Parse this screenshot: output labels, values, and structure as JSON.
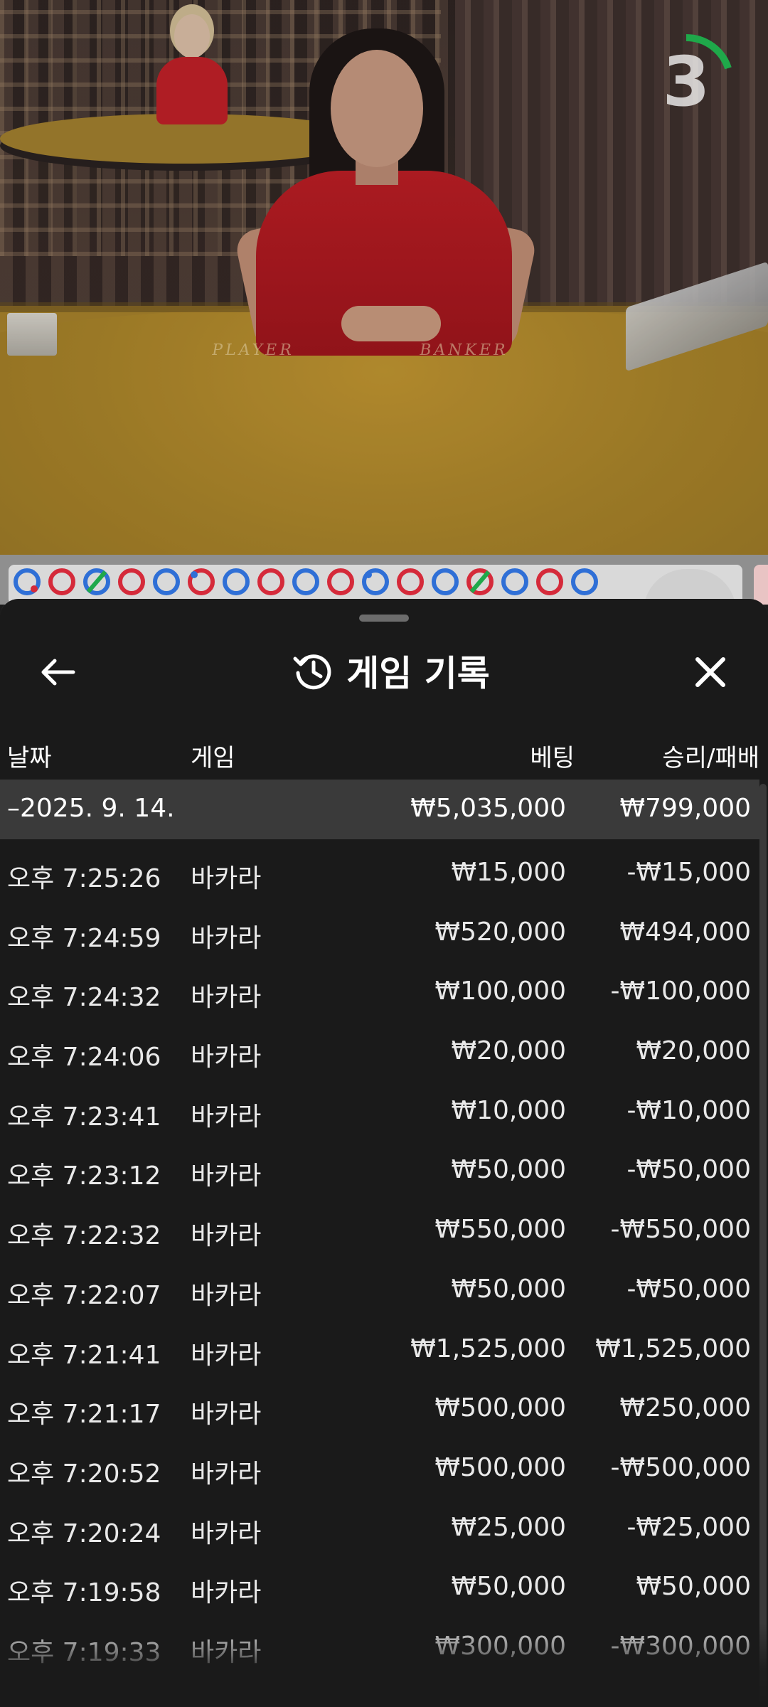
{
  "video": {
    "table_labels": {
      "player": "PLAYER",
      "banker": "BANKER"
    },
    "countdown": {
      "value": "3",
      "ring_color": "#1fa84a",
      "progress_remaining": 0.2
    }
  },
  "road_map": {
    "beads": [
      {
        "color": "blue",
        "mark": "red-dot"
      },
      {
        "color": "red",
        "mark": ""
      },
      {
        "color": "blue",
        "mark": "green-slash"
      },
      {
        "color": "red",
        "mark": ""
      },
      {
        "color": "blue",
        "mark": ""
      },
      {
        "color": "red",
        "mark": "blue-dot"
      },
      {
        "color": "blue",
        "mark": ""
      },
      {
        "color": "red",
        "mark": ""
      },
      {
        "color": "blue",
        "mark": ""
      },
      {
        "color": "red",
        "mark": ""
      },
      {
        "color": "blue",
        "mark": "blue-dot"
      },
      {
        "color": "red",
        "mark": ""
      },
      {
        "color": "blue",
        "mark": ""
      },
      {
        "color": "red",
        "mark": "green-slash"
      },
      {
        "color": "blue",
        "mark": ""
      },
      {
        "color": "red",
        "mark": ""
      },
      {
        "color": "blue",
        "mark": ""
      }
    ],
    "colors": {
      "blue": "#2f6fd6",
      "red": "#d52a3a",
      "green": "#1fa84a"
    }
  },
  "sheet": {
    "title": "게임 기록",
    "icons": {
      "back": "arrow-left-icon",
      "history": "history-icon",
      "close": "close-icon"
    },
    "columns": {
      "date": "날짜",
      "game": "게임",
      "bet": "베팅",
      "result": "승리/패배"
    },
    "group": {
      "date": "–2025. 9. 14.",
      "bet": "₩5,035,000",
      "result": "₩799,000"
    },
    "rows": [
      {
        "time": "오후 7:25:26",
        "game": "바카라",
        "bet": "₩15,000",
        "result": "-₩15,000"
      },
      {
        "time": "오후 7:24:59",
        "game": "바카라",
        "bet": "₩520,000",
        "result": "₩494,000"
      },
      {
        "time": "오후 7:24:32",
        "game": "바카라",
        "bet": "₩100,000",
        "result": "-₩100,000"
      },
      {
        "time": "오후 7:24:06",
        "game": "바카라",
        "bet": "₩20,000",
        "result": "₩20,000"
      },
      {
        "time": "오후 7:23:41",
        "game": "바카라",
        "bet": "₩10,000",
        "result": "-₩10,000"
      },
      {
        "time": "오후 7:23:12",
        "game": "바카라",
        "bet": "₩50,000",
        "result": "-₩50,000"
      },
      {
        "time": "오후 7:22:32",
        "game": "바카라",
        "bet": "₩550,000",
        "result": "-₩550,000"
      },
      {
        "time": "오후 7:22:07",
        "game": "바카라",
        "bet": "₩50,000",
        "result": "-₩50,000"
      },
      {
        "time": "오후 7:21:41",
        "game": "바카라",
        "bet": "₩1,525,000",
        "result": "₩1,525,000"
      },
      {
        "time": "오후 7:21:17",
        "game": "바카라",
        "bet": "₩500,000",
        "result": "₩250,000"
      },
      {
        "time": "오후 7:20:52",
        "game": "바카라",
        "bet": "₩500,000",
        "result": "-₩500,000"
      },
      {
        "time": "오후 7:20:24",
        "game": "바카라",
        "bet": "₩25,000",
        "result": "-₩25,000"
      },
      {
        "time": "오후 7:19:58",
        "game": "바카라",
        "bet": "₩50,000",
        "result": "₩50,000"
      },
      {
        "time": "오후 7:19:33",
        "game": "바카라",
        "bet": "₩300,000",
        "result": "-₩300,000"
      }
    ]
  }
}
